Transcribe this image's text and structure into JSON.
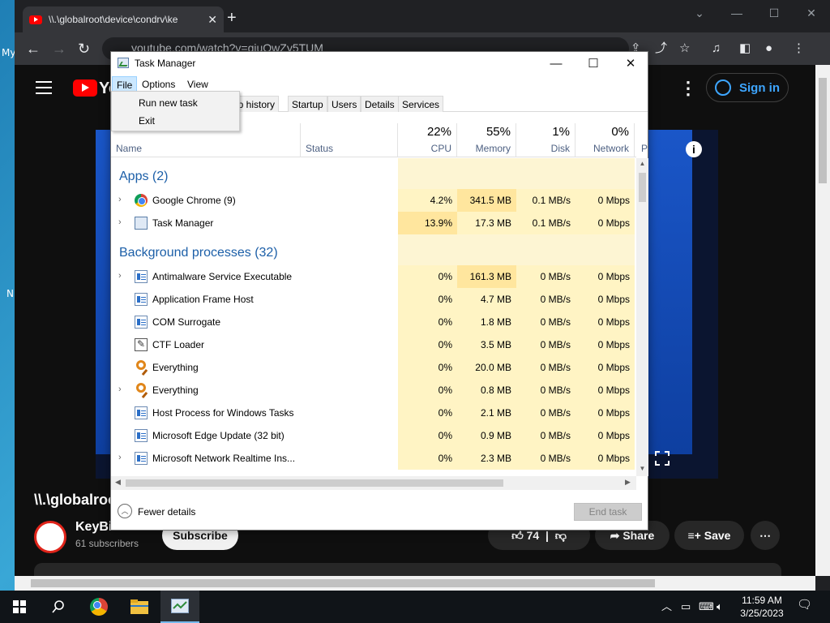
{
  "desktop": {
    "frag_my": "My",
    "frag_n": "N"
  },
  "chrome": {
    "tab_title": "\\\\.\\globalroot\\device\\condrv\\ke",
    "url": "youtube.com/watch?v=qiuOwZy5TUM",
    "new_tab": "+",
    "yt_brand": "Yo",
    "sign_in": "Sign in",
    "video_title": "\\\\.\\globalroo",
    "channel": "KeyBit",
    "subscribers": "61 subscribers",
    "subscribe": "Subscribe",
    "likes": "74",
    "share": "Share",
    "save": "Save"
  },
  "taskmanager": {
    "title": "Task Manager",
    "menu": {
      "file": "File",
      "options": "Options",
      "view": "View"
    },
    "file_menu": {
      "run_new_task": "Run new task",
      "exit": "Exit"
    },
    "tabs": [
      "pp history",
      "Startup",
      "Users",
      "Details",
      "Services"
    ],
    "columns": {
      "name": "Name",
      "status": "Status",
      "cpu_pct": "22%",
      "cpu": "CPU",
      "mem_pct": "55%",
      "mem": "Memory",
      "disk_pct": "1%",
      "disk": "Disk",
      "net_pct": "0%",
      "net": "Network",
      "p": "P"
    },
    "groups": {
      "apps": "Apps (2)",
      "background": "Background processes (32)"
    },
    "apps": [
      {
        "name": "Google Chrome (9)",
        "cpu": "4.2%",
        "mem": "341.5 MB",
        "disk": "0.1 MB/s",
        "net": "0 Mbps"
      },
      {
        "name": "Task Manager",
        "cpu": "13.9%",
        "mem": "17.3 MB",
        "disk": "0.1 MB/s",
        "net": "0 Mbps"
      }
    ],
    "background": [
      {
        "name": "Antimalware Service Executable",
        "cpu": "0%",
        "mem": "161.3 MB",
        "disk": "0 MB/s",
        "net": "0 Mbps"
      },
      {
        "name": "Application Frame Host",
        "cpu": "0%",
        "mem": "4.7 MB",
        "disk": "0 MB/s",
        "net": "0 Mbps"
      },
      {
        "name": "COM Surrogate",
        "cpu": "0%",
        "mem": "1.8 MB",
        "disk": "0 MB/s",
        "net": "0 Mbps"
      },
      {
        "name": "CTF Loader",
        "cpu": "0%",
        "mem": "3.5 MB",
        "disk": "0 MB/s",
        "net": "0 Mbps"
      },
      {
        "name": "Everything",
        "cpu": "0%",
        "mem": "20.0 MB",
        "disk": "0 MB/s",
        "net": "0 Mbps"
      },
      {
        "name": "Everything",
        "cpu": "0%",
        "mem": "0.8 MB",
        "disk": "0 MB/s",
        "net": "0 Mbps"
      },
      {
        "name": "Host Process for Windows Tasks",
        "cpu": "0%",
        "mem": "2.1 MB",
        "disk": "0 MB/s",
        "net": "0 Mbps"
      },
      {
        "name": "Microsoft Edge Update (32 bit)",
        "cpu": "0%",
        "mem": "0.9 MB",
        "disk": "0 MB/s",
        "net": "0 Mbps"
      },
      {
        "name": "Microsoft Network Realtime Ins...",
        "cpu": "0%",
        "mem": "2.3 MB",
        "disk": "0 MB/s",
        "net": "0 Mbps"
      }
    ],
    "footer": {
      "fewer_details": "Fewer details",
      "end_task": "End task"
    }
  },
  "taskbar": {
    "time": "11:59 AM",
    "date": "3/25/2023"
  }
}
